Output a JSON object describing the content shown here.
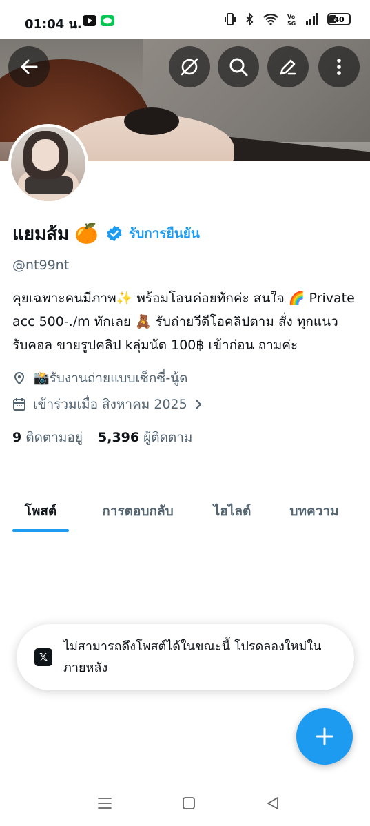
{
  "status_bar": {
    "time": "01:04 น.",
    "battery": "40",
    "battery_level": 0.4,
    "icons": [
      "youtube-icon",
      "line-app-icon",
      "vibrate-icon",
      "bluetooth-icon",
      "wifi-icon",
      "volte-5g-icon",
      "signal-icon",
      "battery-icon"
    ]
  },
  "header": {
    "back_icon": "arrow-left-icon",
    "actions": [
      "grok-icon",
      "search-icon",
      "edit-icon",
      "more-vertical-icon"
    ]
  },
  "profile": {
    "display_name": "แยมส้ม",
    "name_emoji": "🍊",
    "verified_badge": "verified-badge-icon",
    "verify_link": "รับการยืนยัน",
    "handle": "@nt99nt",
    "bio": "คุยเฉพาะคนมีภาพ✨ พร้อมโอนค่อยทักค่ะ สนใจ 🌈 Private acc 500-./m ทักเลย  🧸 รับถ่ายวีดีโอคลิปตาม สั่ง ทุกแนว รับคอล ขายรูปคลิป kลุ่มนัด 100฿ เข้าก่อน ถามค่ะ",
    "location": "📸รับงานถ่ายแบบเซ็กซี่-นู้ด",
    "joined": "เข้าร่วมเมื่อ สิงหาคม 2025",
    "following_count": "9",
    "following_label": "ติดตามอยู่",
    "followers_count": "5,396",
    "followers_label": "ผู้ติดตาม"
  },
  "tabs": [
    {
      "label": "โพสต์",
      "active": true
    },
    {
      "label": "การตอบกลับ",
      "active": false
    },
    {
      "label": "ไฮไลต์",
      "active": false
    },
    {
      "label": "บทความ",
      "active": false
    }
  ],
  "toast": {
    "logo": "𝕏",
    "message": "ไม่สามารถดึงโพสต์ได้ในขณะนี้ โปรดลองใหม่ในภายหลัง"
  },
  "fab": {
    "icon": "plus-icon"
  },
  "nav": {
    "icons": [
      "recent-apps-icon",
      "home-icon",
      "back-icon"
    ]
  },
  "colors": {
    "accent": "#1d9bf0",
    "text": "#0f1419",
    "secondary": "#536471"
  }
}
